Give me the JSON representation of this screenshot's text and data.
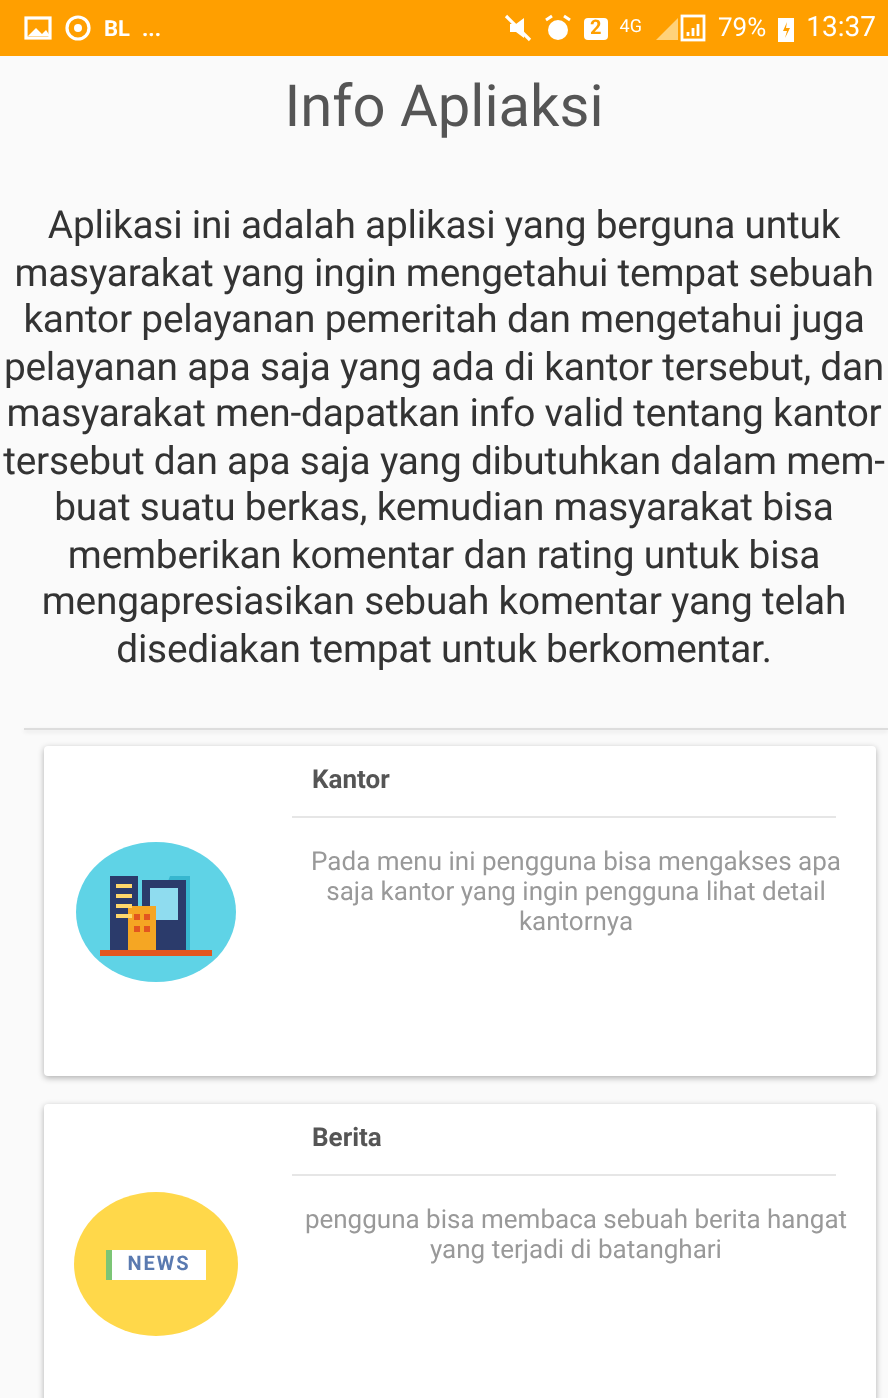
{
  "status_bar": {
    "left_texts": [
      "BL",
      "..."
    ],
    "badge": "2",
    "network": "4G",
    "battery": "79%",
    "time": "13:37"
  },
  "title": "Info Apliaksi",
  "description": "Aplikasi ini adalah aplikasi yang berguna untuk masyarakat yang ingin mengetahui tempat sebuah kantor pelayanan pemeritah dan mengetahui juga pelayanan apa saja yang ada di kantor tersebut, dan masyarakat men-dapatkan info valid tentang kantor tersebut dan apa saja yang dibutuhkan dalam mem-buat suatu berkas, kemudian masyarakat bisa memberikan komentar dan rating untuk bisa mengapresiasikan sebuah komentar yang telah disediakan tempat untuk berkomentar.",
  "menu_cards": [
    {
      "kind": "office",
      "title": "Kantor",
      "text": "Pada menu ini pengguna bisa mengakses apa saja kantor yang ingin pengguna lihat detail kantornya"
    },
    {
      "kind": "news",
      "icon_label": "NEWS",
      "title": "Berita",
      "text": "pengguna bisa membaca sebuah berita hangat yang terjadi di batanghari"
    }
  ]
}
